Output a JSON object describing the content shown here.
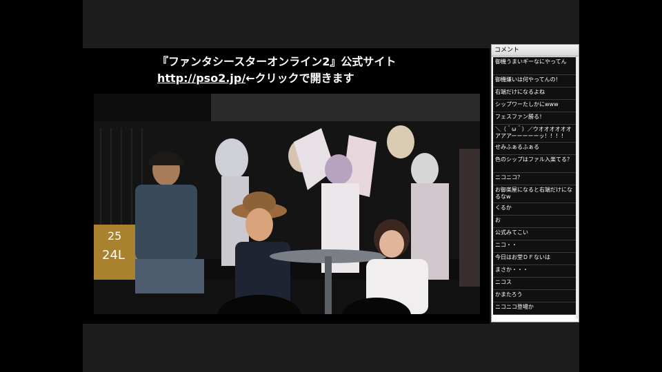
{
  "banner": {
    "line1": "『ファンタシースターオンライン2』公式サイト",
    "link": "http://pso2.jp/",
    "line2_suffix": "←クリックで開きます"
  },
  "stage": {
    "seat_numbers": [
      "25",
      "24L"
    ]
  },
  "comments": {
    "header": "コメント",
    "items": [
      "御機うまいギーなにやってん",
      "御機嫌いは何やってんの！",
      "右端だけになるよね",
      "シップワーたしかにwww",
      "フェスファン勝る！",
      "＼（＾ω＾）／ウオオオオオオアアアーーーーーッ！！！！",
      "せみふぁるふぁる",
      "色のシップはファル入楽てる？",
      "ニコニコ？",
      "お御楽屋になると右端だけになるなw",
      "くるか",
      "お",
      "公式みてこい",
      "ニコ・・",
      "今日はお堂ＤＦないは",
      "まさか・・・",
      "ニコス",
      "かまたろう",
      "ニコニコ登場か"
    ]
  },
  "colors": {
    "background": "#000000",
    "frame": "#1b1b1b",
    "comment_bg": "#101010",
    "comment_text": "#ffffff"
  }
}
